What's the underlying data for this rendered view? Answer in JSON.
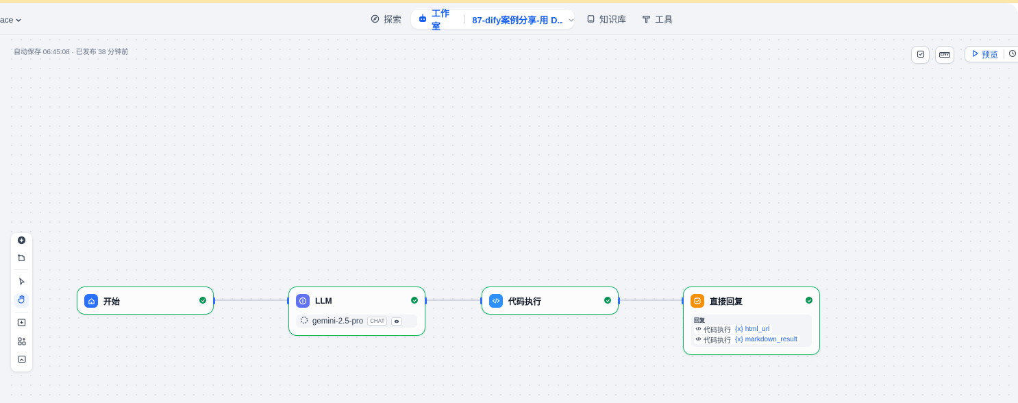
{
  "header": {
    "workspace_label": "ace",
    "nav": {
      "explore": "探索",
      "studio": "工作室",
      "app_name": "87-dify案例分享-用 D...",
      "knowledge": "知识库",
      "tools": "工具"
    }
  },
  "canvas": {
    "autosave": "自动保存 06:45:08 · 已发布 38 分钟前",
    "top_buttons": {
      "preview": "预览",
      "env_icon": "ENV"
    }
  },
  "nodes": {
    "start": {
      "title": "开始",
      "status": "success"
    },
    "llm": {
      "title": "LLM",
      "model": "gemini-2.5-pro",
      "mode_tag": "CHAT"
    },
    "code": {
      "title": "代码执行"
    },
    "answer": {
      "title": "直接回复",
      "section_label": "回复",
      "vars": [
        {
          "node": "代码执行",
          "prefix": "{x}",
          "name": "html_url"
        },
        {
          "node": "代码执行",
          "prefix": "{x}",
          "name": "markdown_result"
        }
      ]
    }
  },
  "colors": {
    "accent": "#155eef",
    "success": "#079455",
    "start_icon": "#2970ff",
    "llm_icon": "#6172f3",
    "code_icon": "#2e90fa",
    "answer_icon": "#f79009"
  },
  "icons": [
    "compass-icon",
    "robot-icon",
    "book-icon",
    "tool-icon",
    "plus-circle-icon",
    "note-icon",
    "pointer-icon",
    "hand-icon",
    "export-image-icon",
    "organize-icon",
    "minimap-icon",
    "home-icon",
    "brain-icon",
    "code-icon",
    "reply-icon",
    "check-circle-icon",
    "play-icon",
    "history-icon",
    "env-icon",
    "checklist-icon"
  ]
}
